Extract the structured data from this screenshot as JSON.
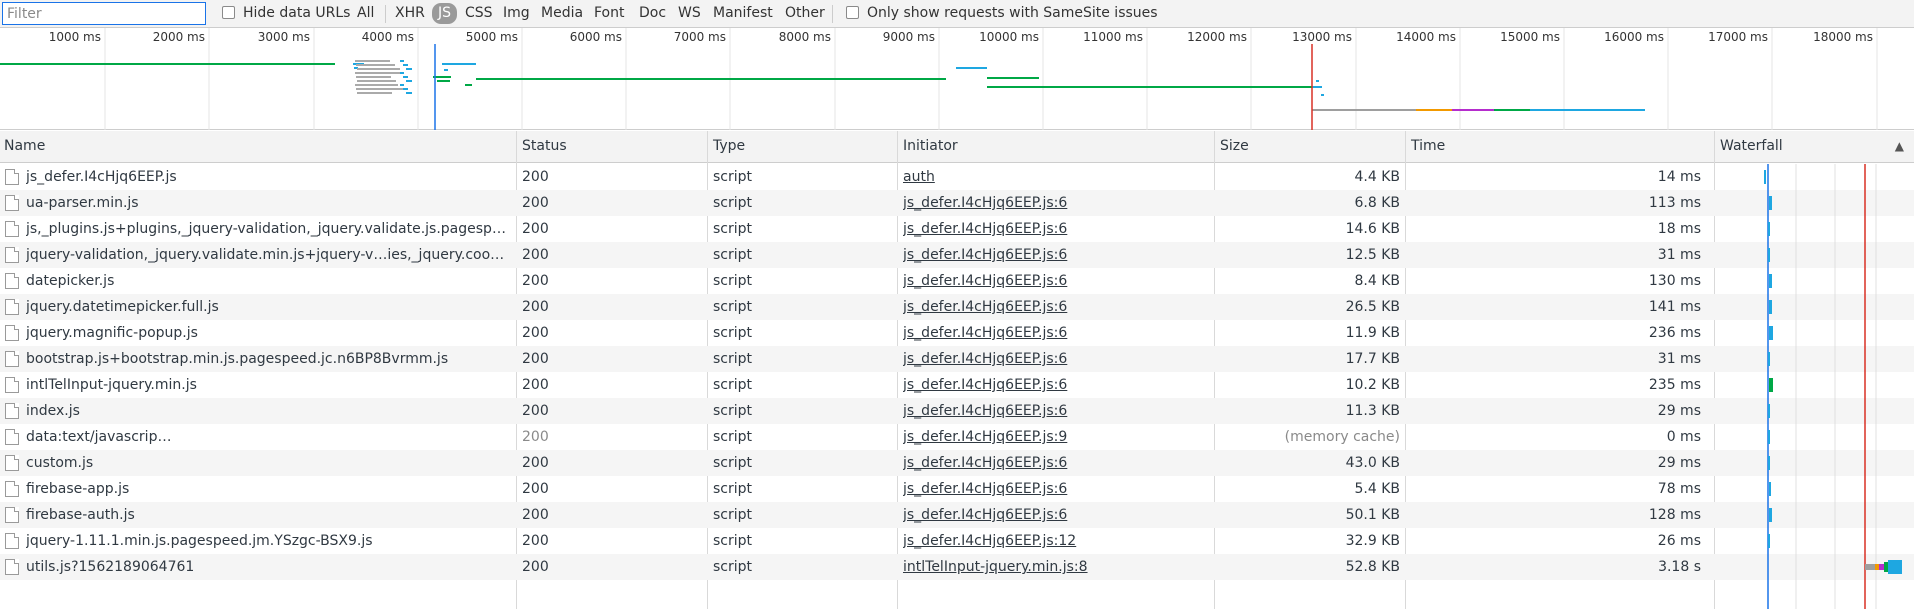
{
  "filter": {
    "placeholder": "Filter",
    "value": ""
  },
  "filterbar": {
    "hide_data_urls": "Hide data URLs",
    "types": [
      "All",
      "XHR",
      "JS",
      "CSS",
      "Img",
      "Media",
      "Font",
      "Doc",
      "WS",
      "Manifest",
      "Other"
    ],
    "active_type": "JS",
    "samesite": "Only show requests with SameSite issues"
  },
  "overview": {
    "ticks": [
      "1000 ms",
      "2000 ms",
      "3000 ms",
      "4000 ms",
      "5000 ms",
      "6000 ms",
      "7000 ms",
      "8000 ms",
      "9000 ms",
      "10000 ms",
      "11000 ms",
      "12000 ms",
      "13000 ms",
      "14000 ms",
      "15000 ms",
      "16000 ms",
      "17000 ms",
      "18000 ms"
    ]
  },
  "columns": {
    "name": "Name",
    "status": "Status",
    "type": "Type",
    "initiator": "Initiator",
    "size": "Size",
    "time": "Time",
    "waterfall": "Waterfall",
    "sort_icon": "▲"
  },
  "rows": [
    {
      "name": "js_defer.I4cHjq6EEP.js",
      "status": "200",
      "type": "script",
      "initiator": "auth",
      "size": "4.4 KB",
      "time": "14 ms"
    },
    {
      "name": "ua-parser.min.js",
      "status": "200",
      "type": "script",
      "initiator": "js_defer.I4cHjq6EEP.js:6",
      "size": "6.8 KB",
      "time": "113 ms"
    },
    {
      "name": "js,_plugins.js+plugins,_jquery-validation,_jquery.validate.js.pagespee…",
      "status": "200",
      "type": "script",
      "initiator": "js_defer.I4cHjq6EEP.js:6",
      "size": "14.6 KB",
      "time": "18 ms"
    },
    {
      "name": "jquery-validation,_jquery.validate.min.js+jquery-v…ies,_jquery.cookie…",
      "status": "200",
      "type": "script",
      "initiator": "js_defer.I4cHjq6EEP.js:6",
      "size": "12.5 KB",
      "time": "31 ms"
    },
    {
      "name": "datepicker.js",
      "status": "200",
      "type": "script",
      "initiator": "js_defer.I4cHjq6EEP.js:6",
      "size": "8.4 KB",
      "time": "130 ms"
    },
    {
      "name": "jquery.datetimepicker.full.js",
      "status": "200",
      "type": "script",
      "initiator": "js_defer.I4cHjq6EEP.js:6",
      "size": "26.5 KB",
      "time": "141 ms"
    },
    {
      "name": "jquery.magnific-popup.js",
      "status": "200",
      "type": "script",
      "initiator": "js_defer.I4cHjq6EEP.js:6",
      "size": "11.9 KB",
      "time": "236 ms"
    },
    {
      "name": "bootstrap.js+bootstrap.min.js.pagespeed.jc.n6BP8Bvrmm.js",
      "status": "200",
      "type": "script",
      "initiator": "js_defer.I4cHjq6EEP.js:6",
      "size": "17.7 KB",
      "time": "31 ms"
    },
    {
      "name": "intlTelInput-jquery.min.js",
      "status": "200",
      "type": "script",
      "initiator": "js_defer.I4cHjq6EEP.js:6",
      "size": "10.2 KB",
      "time": "235 ms"
    },
    {
      "name": "index.js",
      "status": "200",
      "type": "script",
      "initiator": "js_defer.I4cHjq6EEP.js:6",
      "size": "11.3 KB",
      "time": "29 ms"
    },
    {
      "name": "data:text/javascrip…",
      "status": "200",
      "type": "script",
      "initiator": "js_defer.I4cHjq6EEP.js:9",
      "size": "(memory cache)",
      "time": "0 ms",
      "dim": true
    },
    {
      "name": "custom.js",
      "status": "200",
      "type": "script",
      "initiator": "js_defer.I4cHjq6EEP.js:6",
      "size": "43.0 KB",
      "time": "29 ms"
    },
    {
      "name": "firebase-app.js",
      "status": "200",
      "type": "script",
      "initiator": "js_defer.I4cHjq6EEP.js:6",
      "size": "5.4 KB",
      "time": "78 ms"
    },
    {
      "name": "firebase-auth.js",
      "status": "200",
      "type": "script",
      "initiator": "js_defer.I4cHjq6EEP.js:6",
      "size": "50.1 KB",
      "time": "128 ms"
    },
    {
      "name": "jquery-1.11.1.min.js.pagespeed.jm.YSzgc-BSX9.js",
      "status": "200",
      "type": "script",
      "initiator": "js_defer.I4cHjq6EEP.js:12",
      "size": "32.9 KB",
      "time": "26 ms"
    },
    {
      "name": "utils.js?1562189064761",
      "status": "200",
      "type": "script",
      "initiator": "intlTelInput-jquery.min.js:8",
      "size": "52.8 KB",
      "time": "3.18 s"
    }
  ],
  "colors": {
    "accent": "#1a73e8",
    "waiting": "#00a846",
    "download": "#1ea7e1",
    "load_line": "#d93025",
    "dcl_line": "#1a73e8",
    "ssl": "#b52dcd",
    "connect": "#f29900",
    "stalled": "#9e9e9e"
  }
}
